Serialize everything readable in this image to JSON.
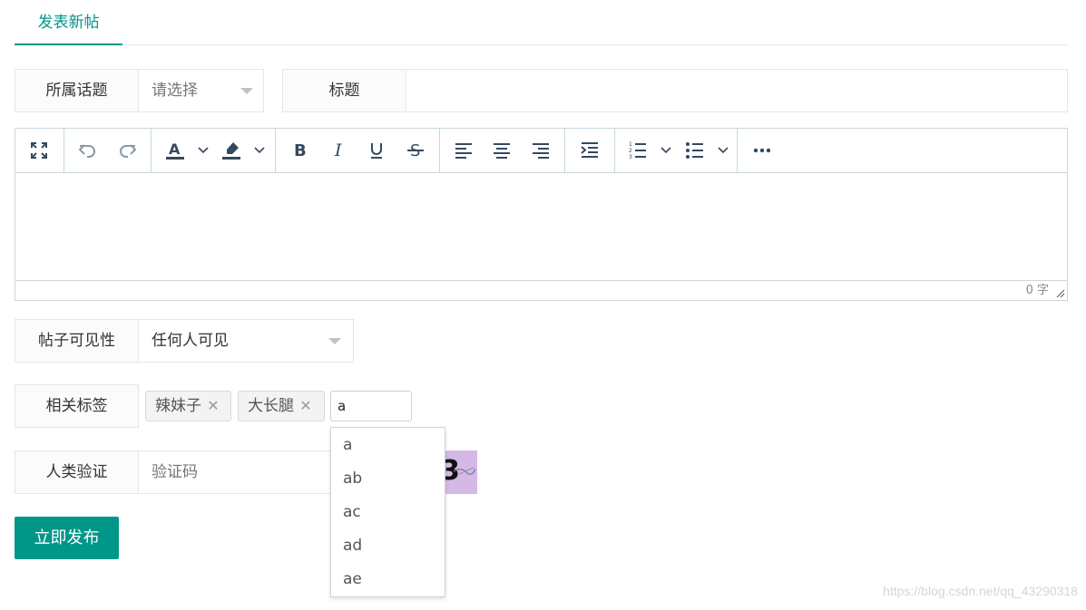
{
  "tab": {
    "label": "发表新帖"
  },
  "topic": {
    "label": "所属话题",
    "placeholder": "请选择"
  },
  "title": {
    "label": "标题",
    "value": ""
  },
  "editor": {
    "toolbar": [
      "fullscreen-icon",
      "undo-icon",
      "redo-icon",
      "font-color-icon",
      "highlight-icon",
      "bold-icon",
      "italic-icon",
      "underline-icon",
      "strikethrough-icon",
      "align-left-icon",
      "align-center-icon",
      "align-right-icon",
      "indent-icon",
      "ordered-list-icon",
      "bullet-list-icon",
      "more-icon"
    ],
    "content": "",
    "word_count": "0 字"
  },
  "visibility": {
    "label": "帖子可见性",
    "value": "任何人可见"
  },
  "tags": {
    "label": "相关标签",
    "items": [
      "辣妹子",
      "大长腿"
    ],
    "input_value": "a",
    "suggestions": [
      "a",
      "ab",
      "ac",
      "ad",
      "ae"
    ]
  },
  "captcha": {
    "label": "人类验证",
    "placeholder": "验证码",
    "image_text": "3"
  },
  "publish": {
    "label": "立即发布"
  },
  "watermark": "https://blog.csdn.net/qq_43290318",
  "colors": {
    "accent": "#009688",
    "border": "#e6e6e6",
    "toolbar_icon": "#34495e"
  }
}
